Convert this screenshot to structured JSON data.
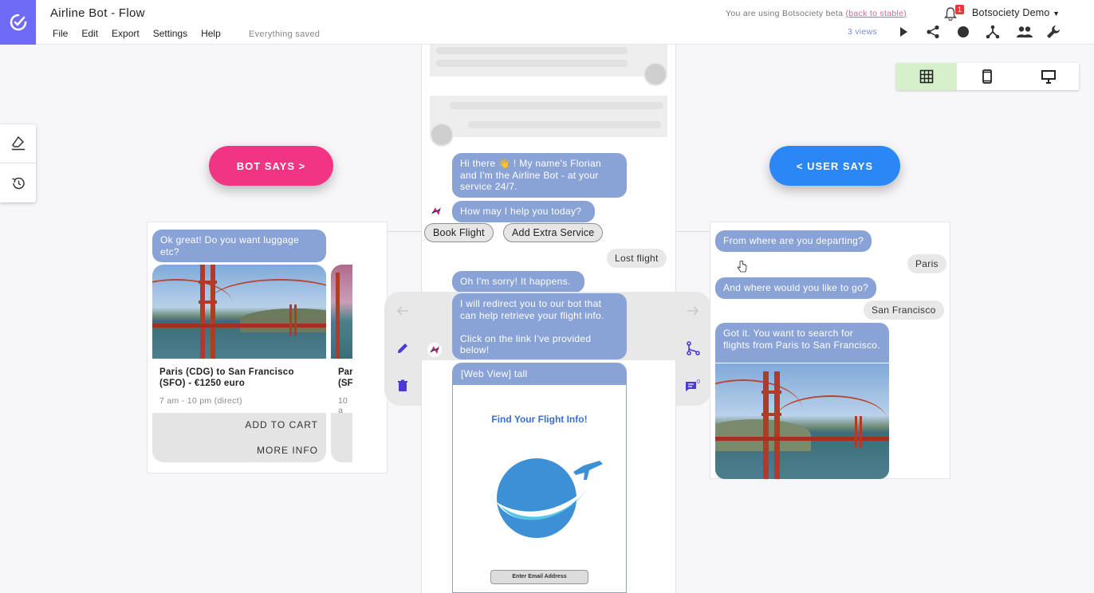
{
  "header": {
    "title": "Airline Bot - Flow",
    "menu": [
      "File",
      "Edit",
      "Export",
      "Settings",
      "Help"
    ],
    "saved_status": "Everything saved",
    "beta_text": "You are using Botsociety beta",
    "beta_link": "(back to stable)",
    "notification_count": "1",
    "account": "Botsociety Demo",
    "views": "3 views"
  },
  "buttons": {
    "bot_says": "BOT SAYS >",
    "user_says": "< USER SAYS"
  },
  "left_card": {
    "message": "Ok great! Do you want luggage etc?",
    "carousel": {
      "title": "Paris (CDG) to San Francisco (SFO) - €1250 euro",
      "subtitle": "7 am - 10 pm (direct)",
      "add_to_cart": "ADD TO CART",
      "more_info": "MORE INFO",
      "peek_title": "Par",
      "peek_title2": "(SF",
      "peek_subtitle": "10 a"
    }
  },
  "middle": {
    "greeting": "Hi there 👋 ! My name's Florian and I'm the Airline Bot - at your service 24/7.",
    "question": "How may I help you today?",
    "quick_replies": [
      "Book Flight",
      "Add Extra Service"
    ],
    "user_reply": "Lost flight",
    "sorry": "Oh I'm sorry! It happens.",
    "redirect": "I will redirect you to our bot that can help retrieve your flight info.",
    "redirect2": "Click on the link I've provided below!",
    "webview_label": "[Web View] tall",
    "webview_title": "Find Your Flight Info!",
    "webview_button": "Enter Email Address"
  },
  "right_card": {
    "q1": "From where are you departing?",
    "a1": "Paris",
    "q2": "And where would you like to go?",
    "a2": "San Francisco",
    "q3": "Got it. You want to search for flights from Paris to San Francisco."
  },
  "colors": {
    "brand": "#6e6af6",
    "bot_says": "#ef3583",
    "user_says": "#2b87f5",
    "bot_bubble": "#8aa3d6",
    "active_view": "#d6f0cc"
  },
  "icons": [
    "bell-icon",
    "play-icon",
    "share-icon",
    "record-icon",
    "branch-icon",
    "people-icon",
    "wrench-icon",
    "grid-icon",
    "phone-icon",
    "desktop-icon",
    "eraser-icon",
    "history-icon",
    "pencil-icon",
    "trash-icon",
    "arrow-left-icon",
    "arrow-right-icon",
    "path-icon",
    "comment-icon"
  ]
}
